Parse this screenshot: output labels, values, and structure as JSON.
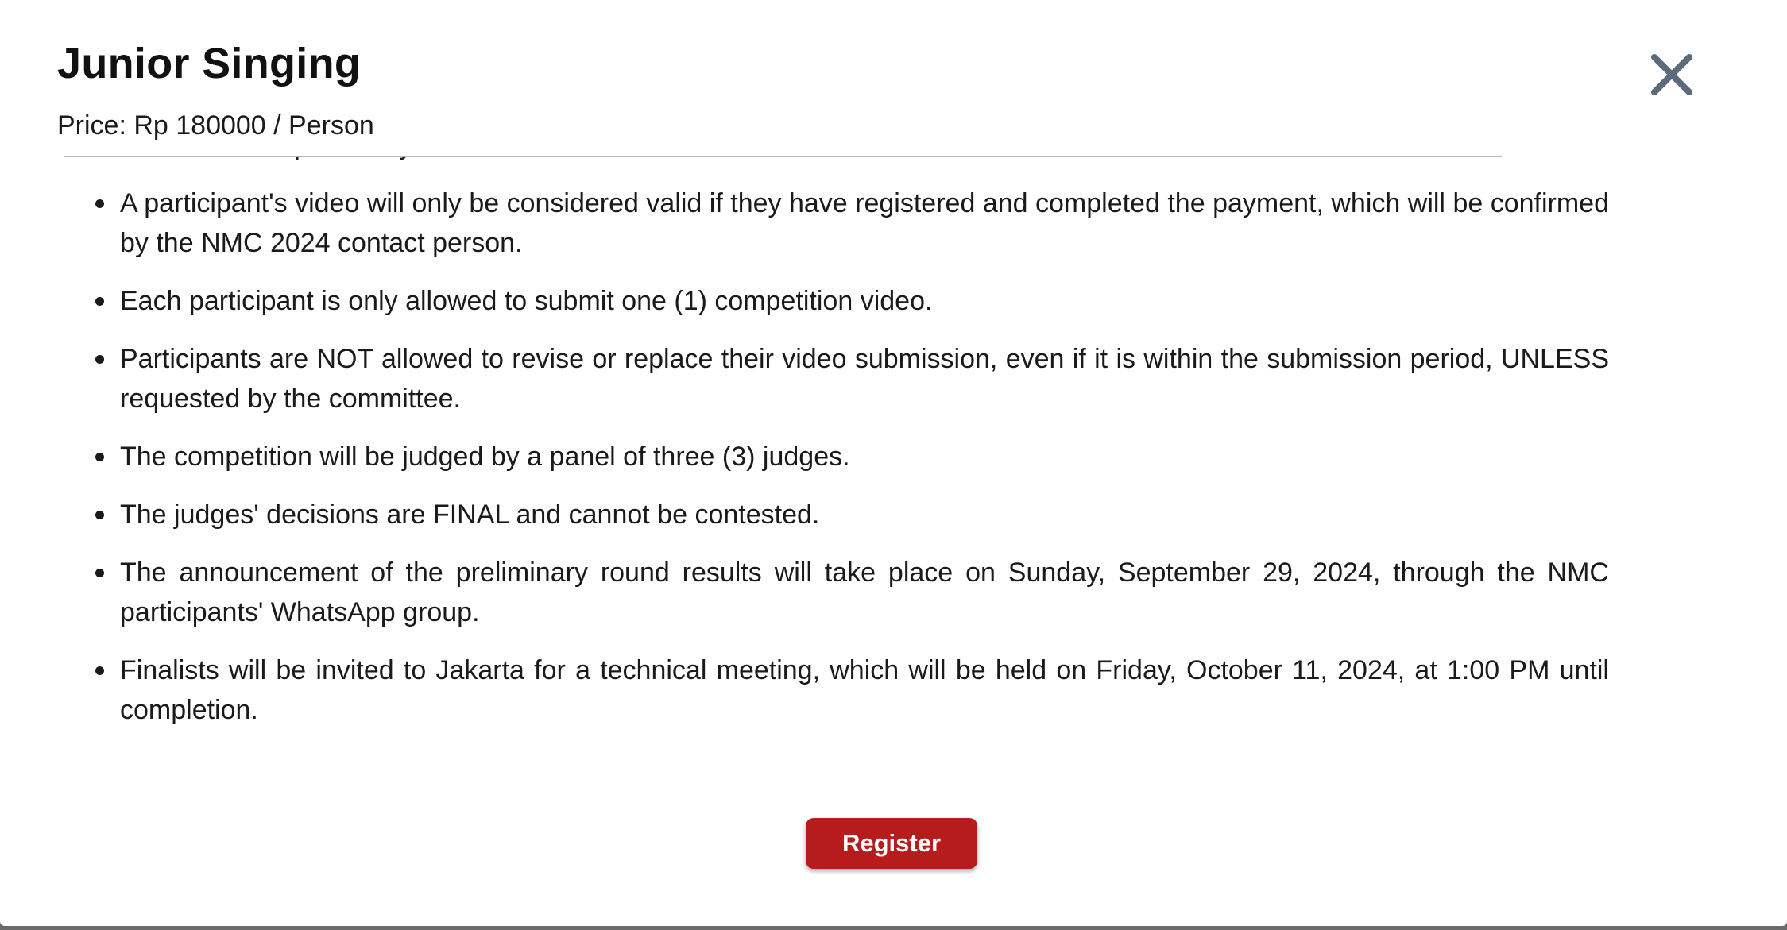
{
  "modal": {
    "title": "Junior Singing",
    "price": "Price: Rp 180000 / Person",
    "close_icon": "close-icon"
  },
  "rules": {
    "clipped_tail": "are not the responsibility of the committee.",
    "items": [
      "A participant's video will only be considered valid if they have registered and completed the payment, which will be confirmed by the NMC 2024 contact person.",
      "Each participant is only allowed to submit one (1) competition video.",
      "Participants are NOT allowed to revise or replace their video submission, even if it is within the submission period, UNLESS requested by the committee.",
      "The competition will be judged by a panel of three (3) judges.",
      "The judges' decisions are FINAL and cannot be contested.",
      "The announcement of the preliminary round results will take place on Sunday, September 29, 2024, through the NMC participants' WhatsApp group.",
      "Finalists will be invited to Jakarta for a technical meeting, which will be held on Friday, October 11, 2024, at 1:00 PM until completion."
    ]
  },
  "actions": {
    "register_label": "Register"
  },
  "colors": {
    "accent": "#b71c1c",
    "close_icon": "#5c6b7a",
    "backdrop": "#6b6b6b"
  }
}
